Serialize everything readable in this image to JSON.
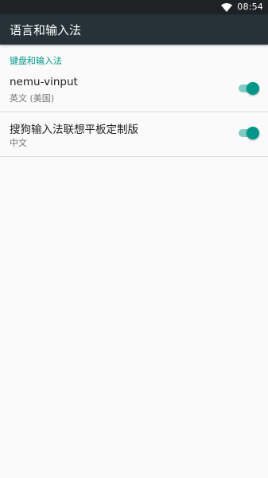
{
  "status_bar": {
    "time": "08:54",
    "icons": [
      "wifi-icon"
    ]
  },
  "app_bar": {
    "title": "语言和输入法"
  },
  "section": {
    "header": "键盘和输入法",
    "items": [
      {
        "title": "nemu-vinput",
        "summary": "英文 (美国)",
        "enabled": true
      },
      {
        "title": "搜狗输入法联想平板定制版",
        "summary": "中文",
        "enabled": true
      }
    ]
  },
  "colors": {
    "accent": "#009688",
    "accent_track": "#80cbc4",
    "app_bar": "#263238",
    "status_bar": "#1f2224",
    "background": "#fafafa"
  }
}
